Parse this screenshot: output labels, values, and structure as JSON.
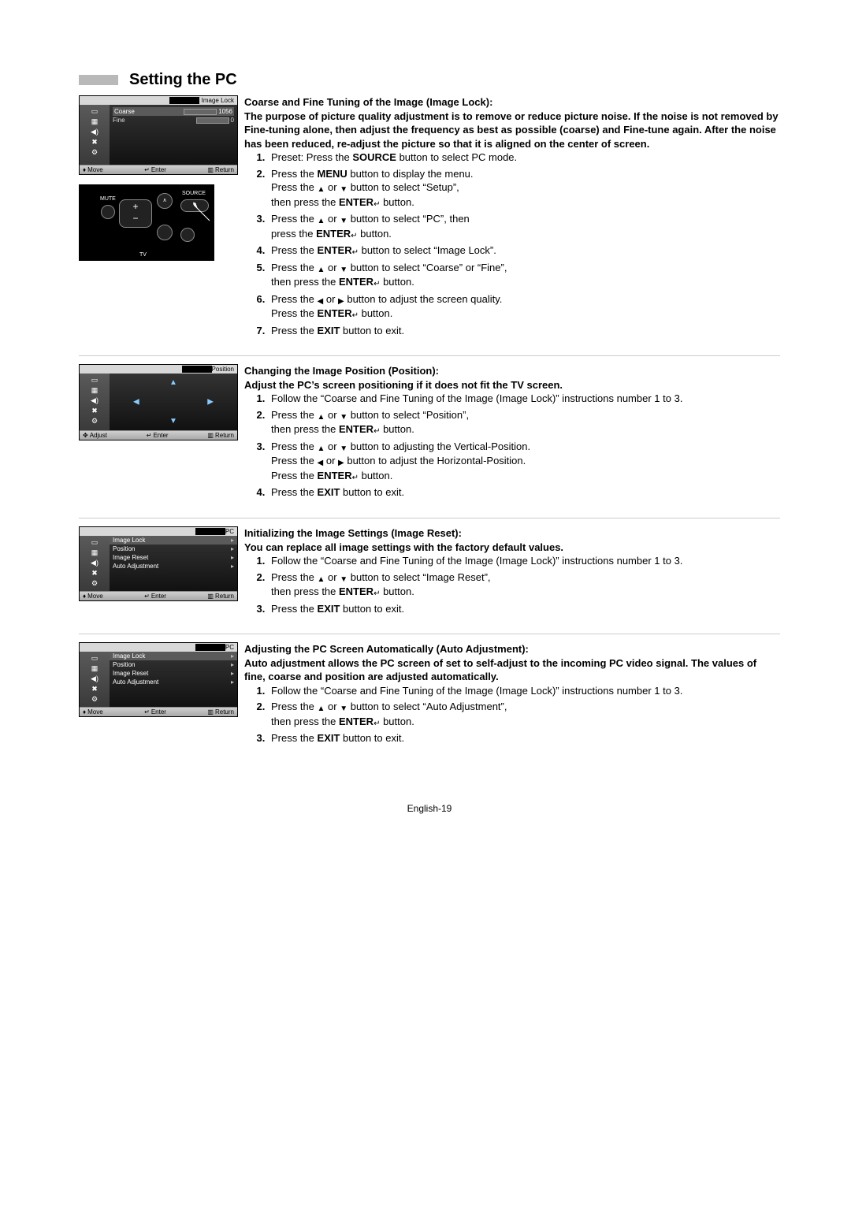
{
  "page_title": "Setting the PC",
  "footer": "English-19",
  "osd_image_lock": {
    "title": "Image Lock",
    "rows": [
      {
        "label": "Coarse",
        "value": "1056",
        "fill": 95
      },
      {
        "label": "Fine",
        "value": "0",
        "fill": 0
      }
    ],
    "footer": {
      "left": "Move",
      "center": "Enter",
      "right": "Return"
    }
  },
  "osd_position": {
    "title": "Position",
    "footer": {
      "left": "Adjust",
      "center": "Enter",
      "right": "Return"
    }
  },
  "osd_pc_menu_a": {
    "title": "PC",
    "items": [
      "Image Lock",
      "Position",
      "Image Reset",
      "Auto Adjustment"
    ],
    "footer": {
      "left": "Move",
      "center": "Enter",
      "right": "Return"
    }
  },
  "osd_pc_menu_b": {
    "title": "PC",
    "items": [
      "Image Lock",
      "Position",
      "Image Reset",
      "Auto Adjustment"
    ],
    "footer": {
      "left": "Move",
      "center": "Enter",
      "right": "Return"
    }
  },
  "remote": {
    "mute": "MUTE",
    "source": "SOURCE",
    "tv": "TV"
  },
  "sec1": {
    "heading": "Coarse and Fine Tuning of the Image (Image Lock):",
    "intro": "The purpose of picture quality adjustment is to remove or reduce picture noise. If the noise is not removed by Fine-tuning alone, then adjust the frequency as best as possible (coarse) and Fine-tune again. After the noise has been reduced, re-adjust the picture so that it is aligned on the center of screen.",
    "steps": {
      "s1": "Preset: Press the <b>SOURCE</b> button to select PC mode.",
      "s2": "Press the <b>MENU</b> button to display the menu.<br>Press the <span class='glyph'>▲</span> or <span class='glyph'>▼</span> button to select “Setup”,<br>then press the <b>ENTER</b><span class='glyph'>↵</span> button.",
      "s3": "Press the <span class='glyph'>▲</span> or <span class='glyph'>▼</span> button to select “PC”, then<br>press the <b>ENTER</b><span class='glyph'>↵</span> button.",
      "s4": "Press the <b>ENTER</b><span class='glyph'>↵</span> button to select “Image Lock”.",
      "s5": "Press the <span class='glyph'>▲</span> or <span class='glyph'>▼</span> button to select “Coarse” or “Fine”,<br>then press the <b>ENTER</b><span class='glyph'>↵</span> button.",
      "s6": "Press the <span class='glyph'>◀</span> or <span class='glyph'>▶</span> button to adjust the screen quality.<br>Press the <b>ENTER</b><span class='glyph'>↵</span> button.",
      "s7": "Press the <b>EXIT</b> button to exit."
    }
  },
  "sec2": {
    "heading": "Changing the Image Position (Position):",
    "intro": "Adjust the PC’s screen positioning if it does not fit the TV screen.",
    "steps": {
      "s1": "Follow the “Coarse and Fine Tuning of the Image (Image Lock)” instructions number 1 to 3.",
      "s2": "Press the <span class='glyph'>▲</span> or <span class='glyph'>▼</span> button to select “Position”,<br>then press the <b>ENTER</b><span class='glyph'>↵</span> button.",
      "s3": "Press the <span class='glyph'>▲</span> or <span class='glyph'>▼</span> button to adjusting the Vertical-Position.<br>Press the <span class='glyph'>◀</span> or <span class='glyph'>▶</span> button to adjust the Horizontal-Position.<br>Press the <b>ENTER</b><span class='glyph'>↵</span> button.",
      "s4": "Press the <b>EXIT</b> button to exit."
    }
  },
  "sec3": {
    "heading": "Initializing the Image Settings (Image Reset):",
    "intro": "You can replace all image settings with the factory default values.",
    "steps": {
      "s1": "Follow the “Coarse and Fine Tuning of the Image (Image Lock)” instructions number 1 to 3.",
      "s2": "Press the <span class='glyph'>▲</span> or <span class='glyph'>▼</span> button to select “Image Reset”,<br>then press the <b>ENTER</b><span class='glyph'>↵</span> button.",
      "s3": "Press the <b>EXIT</b> button to exit."
    }
  },
  "sec4": {
    "heading": "Adjusting the PC Screen Automatically (Auto Adjustment):",
    "intro": "Auto adjustment allows the PC screen of set to self-adjust to the incoming PC video signal. The values of fine, coarse and position are adjusted automatically.",
    "steps": {
      "s1": "Follow the “Coarse and Fine Tuning of the Image (Image Lock)” instructions number 1 to 3.",
      "s2": "Press the <span class='glyph'>▲</span> or <span class='glyph'>▼</span> button to select “Auto Adjustment”,<br>then press the <b>ENTER</b><span class='glyph'>↵</span> button.",
      "s3": "Press the <b>EXIT</b> button to exit."
    }
  }
}
